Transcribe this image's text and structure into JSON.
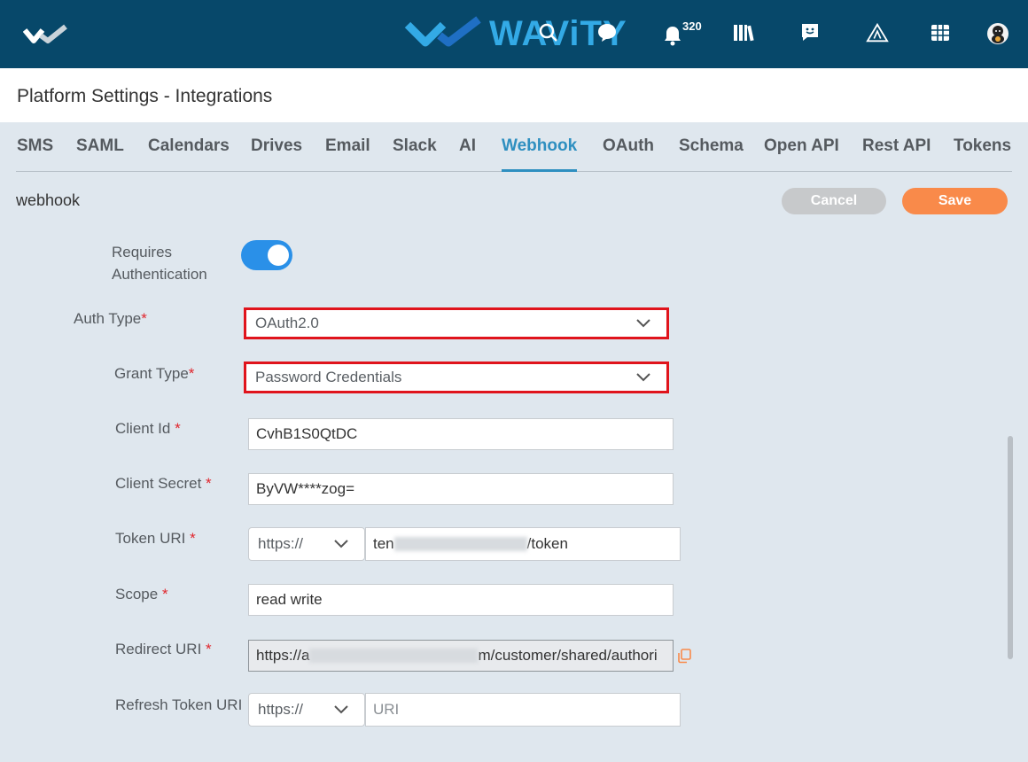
{
  "brand": {
    "name": "WAViTY",
    "accent": "#33aae6",
    "topbar_color": "#07486a"
  },
  "topbar": {
    "notification_count": "320"
  },
  "page": {
    "title": "Platform Settings - Integrations"
  },
  "tabs": [
    {
      "label": "SMS"
    },
    {
      "label": "SAML"
    },
    {
      "label": "Calendars"
    },
    {
      "label": "Drives"
    },
    {
      "label": "Email"
    },
    {
      "label": "Slack"
    },
    {
      "label": "AI"
    },
    {
      "label": "Webhook",
      "active": true
    },
    {
      "label": "OAuth"
    },
    {
      "label": "Schema"
    },
    {
      "label": "Open API"
    },
    {
      "label": "Rest API"
    },
    {
      "label": "Tokens"
    }
  ],
  "section": {
    "label": "webhook"
  },
  "actions": {
    "cancel_label": "Cancel",
    "save_label": "Save"
  },
  "form": {
    "requires_auth": {
      "label_line1": "Requires",
      "label_line2": "Authentication",
      "enabled": true
    },
    "auth_type": {
      "label": "Auth Type",
      "required_mark": "*",
      "value": "OAuth2.0"
    },
    "grant_type": {
      "label": "Grant Type",
      "required_mark": "*",
      "value": "Password Credentials"
    },
    "client_id": {
      "label": "Client Id ",
      "required_mark": "*",
      "value": "CvhB1S0QtDC"
    },
    "client_secret": {
      "label": "Client Secret ",
      "required_mark": "*",
      "value": "ByVW****zog="
    },
    "token_uri": {
      "label": "Token URI ",
      "required_mark": "*",
      "protocol": "https://",
      "value_prefix": "ten",
      "value_suffix": "/token"
    },
    "scope": {
      "label": "Scope ",
      "required_mark": "*",
      "value": "read write"
    },
    "redirect_uri": {
      "label": "Redirect URI ",
      "required_mark": "*",
      "value_prefix": "https://a",
      "value_middle": "m",
      "value_suffix": "/customer/shared/authori"
    },
    "refresh_token_uri": {
      "label": "Refresh Token URI",
      "protocol": "https://",
      "placeholder": "URI"
    }
  },
  "colors": {
    "highlight_border": "#e0141c",
    "active_tab": "#2e8fc0",
    "save": "#f98a4a",
    "cancel": "#c7c9cb",
    "toggle_on": "#2a90e8"
  }
}
